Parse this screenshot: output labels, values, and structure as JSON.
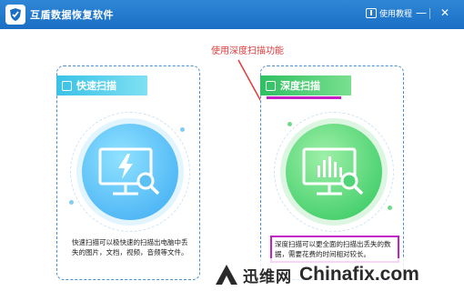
{
  "app": {
    "title": "互盾数据恢复软件",
    "help_label": "使用教程",
    "minimize": "—",
    "close": "✕"
  },
  "annotation": {
    "text": "使用深度扫描功能",
    "color": "#e23b3b"
  },
  "cards": [
    {
      "title": "快速扫描",
      "description": "快速扫描可以极快速的扫描出电脑中丢失的图片，文档，视频，音频等文件。",
      "color": "#3ba9f2",
      "icon": "monitor-lightning-search-icon"
    },
    {
      "title": "深度扫描",
      "description": "深度扫描可以更全面的扫描出丢失的数据，需要花费的时间相对较长。",
      "color": "#2dc65b",
      "icon": "monitor-chart-search-icon"
    }
  ],
  "watermark": {
    "brand": "迅维网",
    "site": "Chinafix.com"
  },
  "colors": {
    "titlebar": "#1a6fc4",
    "highlight": "#c61fc6"
  }
}
